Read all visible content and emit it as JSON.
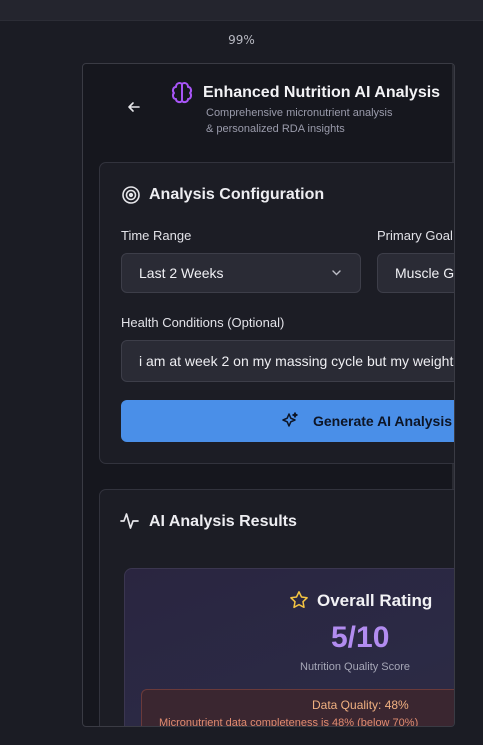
{
  "zoom_level": "99%",
  "header": {
    "title": "Enhanced Nutrition AI Analysis",
    "subtitle_line1": "Comprehensive micronutrient analysis",
    "subtitle_line2": "& personalized RDA insights"
  },
  "config": {
    "section_title": "Analysis Configuration",
    "time_range_label": "Time Range",
    "time_range_value": "Last 2 Weeks",
    "primary_goal_label": "Primary Goal",
    "primary_goal_value": "Muscle Gain",
    "health_label": "Health Conditions (Optional)",
    "health_value": "i am at week 2 on my massing cycle but my weight",
    "generate_label": "Generate AI Analysis"
  },
  "results": {
    "section_title": "AI Analysis Results",
    "rating_title": "Overall Rating",
    "rating_score": "5/10",
    "rating_caption": "Nutrition Quality Score",
    "quality_title": "Data Quality: 48%",
    "quality_note": "Micronutrient data completeness is 48% (below 70%)"
  },
  "colors": {
    "accent_blue": "#4a8fe8",
    "accent_purple": "#b28cf0",
    "star_yellow": "#f5c542",
    "warning_red": "#6a3a3a"
  }
}
